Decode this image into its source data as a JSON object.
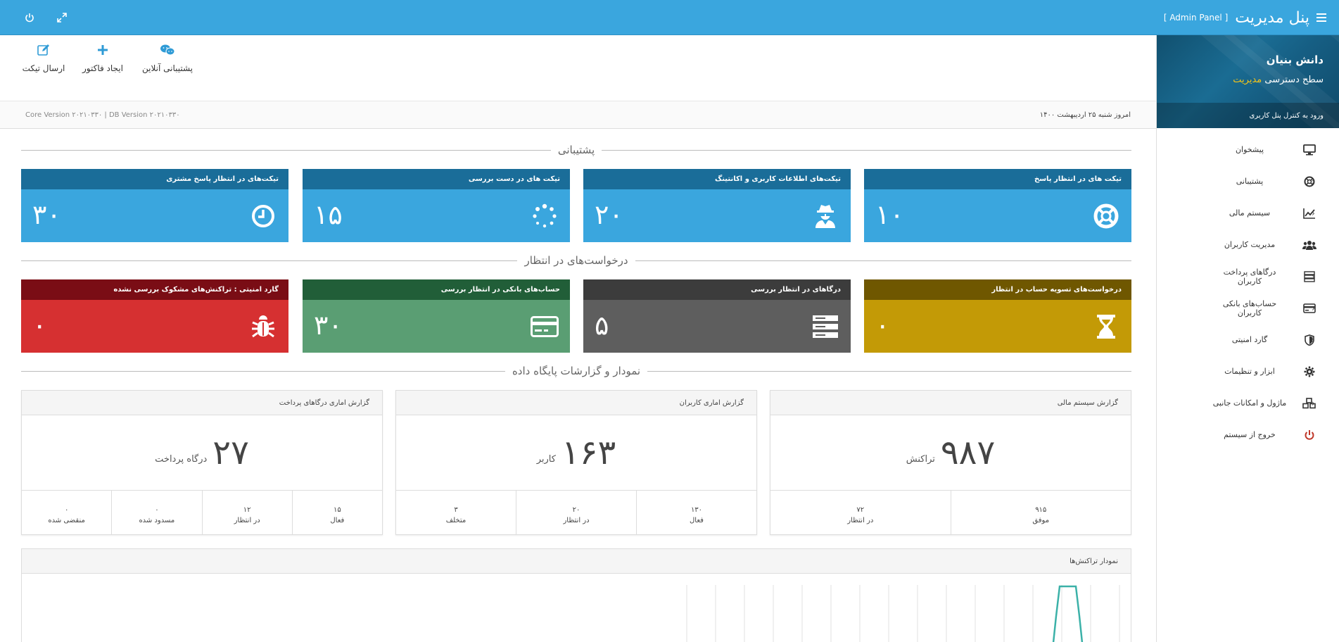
{
  "topbar": {
    "menu_icon": "hamburger-icon",
    "title": "پنل مدیریت",
    "subtitle": "[ Admin Panel ]",
    "fullscreen_icon": "expand-icon",
    "power_icon": "power-icon"
  },
  "sidebar": {
    "profile": {
      "name": "دانش بنیان",
      "level_prefix": "سطح دسترسی",
      "level_value": "مدیریت",
      "login_link": "ورود به کنترل پنل کاربری"
    },
    "items": [
      {
        "label": "پیشخوان",
        "icon": "monitor-icon",
        "has_children": false
      },
      {
        "label": "پشتیبانی",
        "icon": "lifebuoy-icon",
        "has_children": true
      },
      {
        "label": "سیستم مالی",
        "icon": "line-chart-icon",
        "has_children": true
      },
      {
        "label": "مدیریت کاربران",
        "icon": "users-icon",
        "has_children": true
      },
      {
        "label": "درگاهای پرداخت کاربران",
        "icon": "server-icon",
        "has_children": true
      },
      {
        "label": "حساب‌های بانکی کاربران",
        "icon": "credit-card-icon",
        "has_children": true
      },
      {
        "label": "گارد امنیتی",
        "icon": "shield-icon",
        "has_children": true
      },
      {
        "label": "ابزار و تنظیمات",
        "icon": "gear-icon",
        "has_children": true
      },
      {
        "label": "ماژول و امکانات جانبی",
        "icon": "cubes-icon",
        "has_children": true
      },
      {
        "label": "خروج از سیستم",
        "icon": "power-icon",
        "has_children": false
      }
    ],
    "chevron": "‹"
  },
  "quick_actions": [
    {
      "label": "پشتیبانی آنلاین",
      "icon": "chat-icon"
    },
    {
      "label": "ایجاد فاکتور",
      "icon": "plus-icon"
    },
    {
      "label": "ارسال تیکت",
      "icon": "edit-icon"
    }
  ],
  "infobar": {
    "date": "امروز شنبه ۲۵ اردیبهشت ۱۴۰۰",
    "version": "Core Version ۲۰۲۱۰۳۳۰   |   DB Version ۲۰۲۱۰۳۳۰"
  },
  "sections": {
    "support": "پشتیبانی",
    "pending": "درخواست‌های در انتظار",
    "reports": "نمودار و گزارشات پایگاه داده"
  },
  "support_boxes": [
    {
      "title": "تیکت های در انتظار پاسخ",
      "value": "۱۰",
      "icon": "lifebuoy-icon"
    },
    {
      "title": "تیکت‌های اطلاعات کاربری و اکانتینگ",
      "value": "۲۰",
      "icon": "user-secret-icon"
    },
    {
      "title": "تیکت های در دست بررسی",
      "value": "۱۵",
      "icon": "spinner-icon"
    },
    {
      "title": "تیکت‌های در انتظار پاسخ مشتری",
      "value": "۳۰",
      "icon": "clock-icon"
    }
  ],
  "pending_boxes": [
    {
      "title": "درخواست‌های تسویه حساب در انتظار",
      "value": "۰",
      "icon": "hourglass-icon"
    },
    {
      "title": "درگاهای در انتظار بررسی",
      "value": "۵",
      "icon": "server-icon"
    },
    {
      "title": "حساب‌های بانکی در انتظار بررسی",
      "value": "۳۰",
      "icon": "credit-card-icon"
    },
    {
      "title": "گارد امنیتی : تراکنش‌های مشکوک بررسی نشده",
      "value": "۰",
      "icon": "bug-icon"
    }
  ],
  "colors": {
    "topbar": "#3aa6de",
    "box_blue_head": "#1a6d99",
    "box_blue_body": "#3aa6de",
    "box_gold_head": "#6f5700",
    "box_gold_body": "#c39a06",
    "box_gray_head": "#3c3c3c",
    "box_gray_body": "#5e5e5e",
    "box_green_head": "#215e38",
    "box_green_body": "#5a9e73",
    "box_red_head": "#7a0d15",
    "box_red_body": "#d63031",
    "chart_line": "#3bb1a8"
  },
  "reports": [
    {
      "title": "گزارش سیستم مالی",
      "value": "۹۸۷",
      "unit": "تراکنش",
      "stats": [
        {
          "value": "۹۱۵",
          "label": "موفق"
        },
        {
          "value": "۷۲",
          "label": "در انتظار"
        }
      ]
    },
    {
      "title": "گزارش اماری کاربران",
      "value": "۱۶۳",
      "unit": "کاربر",
      "stats": [
        {
          "value": "۱۳۰",
          "label": "فعال"
        },
        {
          "value": "۲۰",
          "label": "در انتظار"
        },
        {
          "value": "۳",
          "label": "متخلف"
        }
      ]
    },
    {
      "title": "گزارش اماری درگاهای پرداخت",
      "value": "۲۷",
      "unit": "درگاه پرداخت",
      "stats": [
        {
          "value": "۱۵",
          "label": "فعال"
        },
        {
          "value": "۱۲",
          "label": "در انتظار"
        },
        {
          "value": "۰",
          "label": "مسدود شده"
        },
        {
          "value": "۰",
          "label": "منقضی شده"
        }
      ]
    }
  ],
  "chart": {
    "title": "نمودار تراکنش‌ها"
  }
}
